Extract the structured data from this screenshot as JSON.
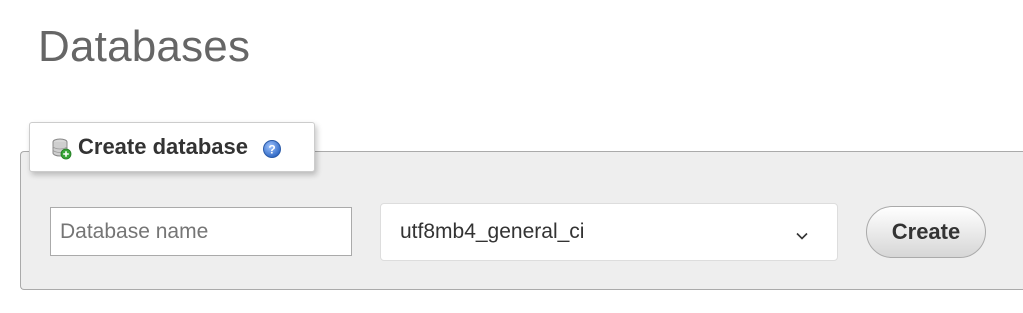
{
  "page": {
    "title": "Databases"
  },
  "create_database": {
    "legend_label": "Create database",
    "name_input": {
      "value": "",
      "placeholder": "Database name"
    },
    "collation_select": {
      "selected": "utf8mb4_general_ci"
    },
    "create_button_label": "Create"
  },
  "icons": {
    "legend_icon": "database-add-icon",
    "help_icon": "help-icon",
    "select_icon": "chevron-down-icon"
  },
  "colors": {
    "title": "#666666",
    "fieldset_bg": "#eeeeee",
    "help_blue": "#3a7bd5",
    "add_green": "#3aa63a"
  }
}
